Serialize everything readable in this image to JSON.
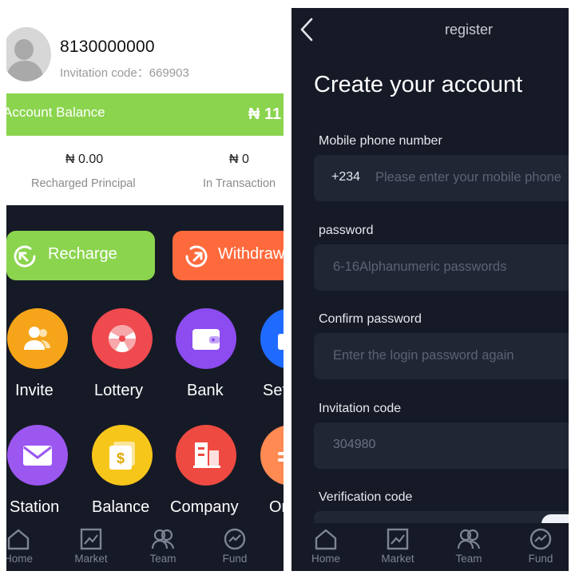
{
  "left": {
    "profile": {
      "phone": "8130000000",
      "invitation": "Invitation code：669903"
    },
    "balance": {
      "label": "Account Balance",
      "value": "₦ 11"
    },
    "stats": [
      {
        "value": "₦ 0.00",
        "label": "Recharged Principal"
      },
      {
        "value": "₦ 0",
        "label": "In Transaction"
      }
    ],
    "actions": {
      "recharge": "Recharge",
      "withdraw": "Withdraw"
    },
    "apps": [
      {
        "label": "Invite",
        "icon": "users-icon",
        "color": "#f6a51a"
      },
      {
        "label": "Lottery",
        "icon": "wheel-icon",
        "color": "#ef4a4f"
      },
      {
        "label": "Bank",
        "icon": "wallet-icon",
        "color": "#8c4cf0"
      },
      {
        "label": "Set",
        "icon": "settings-icon",
        "color": "#1f6bff"
      },
      {
        "label": "Station",
        "icon": "mail-icon",
        "color": "#9b57f0"
      },
      {
        "label": "Balance",
        "icon": "money-icon",
        "color": "#f7c61a"
      },
      {
        "label": "Company",
        "icon": "building-icon",
        "color": "#ee4a41"
      },
      {
        "label": "Or",
        "icon": "order-icon",
        "color": "#ff8a52"
      }
    ],
    "tabs": [
      "Home",
      "Market",
      "Team",
      "Fund"
    ]
  },
  "right": {
    "header": {
      "title": "register"
    },
    "heading": "Create your account",
    "fields": {
      "mobile": {
        "label": "Mobile phone number",
        "code": "+234",
        "placeholder": "Please enter your mobile phone"
      },
      "password": {
        "label": "password",
        "placeholder": "6-16Alphanumeric passwords"
      },
      "confirm": {
        "label": "Confirm password",
        "placeholder": "Enter the login password again"
      },
      "invitation": {
        "label": "Invitation code",
        "value": "304980"
      },
      "verification": {
        "label": "Verification code"
      }
    },
    "tabs": [
      "Home",
      "Market",
      "Team",
      "Fund"
    ]
  },
  "colors": {
    "bg": "#161a26",
    "green": "#8bd44e",
    "orange": "#ff6a3d",
    "field": "#212634"
  }
}
